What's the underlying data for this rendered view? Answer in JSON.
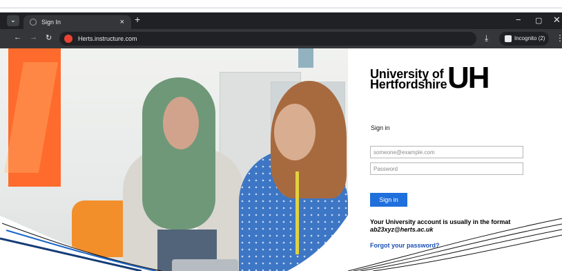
{
  "browser": {
    "tab_title": "Sign In",
    "tab_close": "×",
    "new_tab": "+",
    "menu_icon": "⌄",
    "minimize": "−",
    "restore": "▢",
    "close": "✕",
    "back": "←",
    "forward": "→",
    "reload": "↻",
    "url": "Herts.instructure.com",
    "download": "⤓",
    "incognito_label": "Incognito (2)",
    "more": "⋮"
  },
  "brand": {
    "name_line1": "University of",
    "name_line2": "Hertfordshire",
    "mark": "UH"
  },
  "form": {
    "title": "Sign in",
    "email_placeholder": "someone@example.com",
    "password_placeholder": "Password",
    "submit_label": "Sign in",
    "format_line": "Your University account is usually in the format",
    "format_example": "ab23xyz@herts.ac.uk",
    "forgot_label": "Forgot your password?"
  },
  "colors": {
    "accent": "#1f6fdc",
    "link": "#1a4fb3",
    "browser_dark": "#202124"
  },
  "icons": {
    "tab_favicon": "globe-icon",
    "site_icon": "red-site-icon",
    "incognito_icon": "incognito-icon"
  }
}
